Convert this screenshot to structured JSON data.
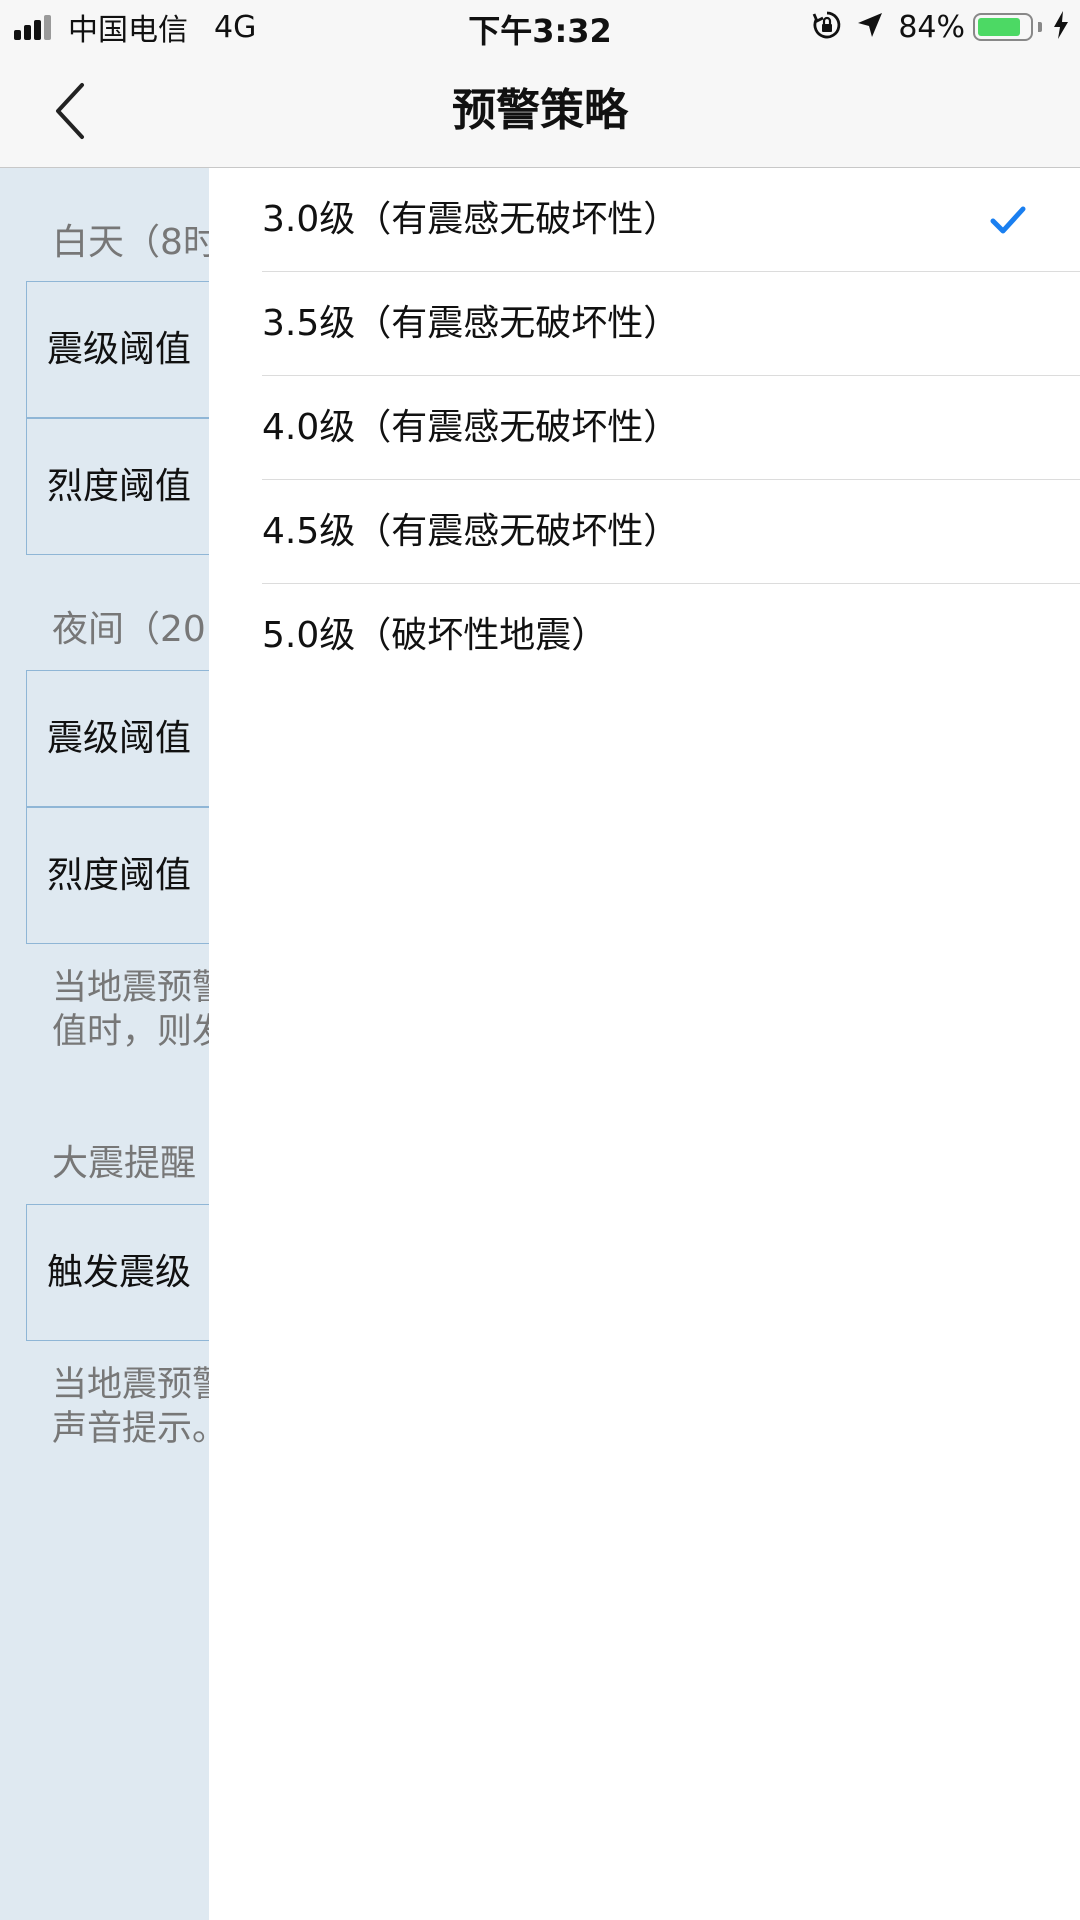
{
  "status_bar": {
    "carrier": "中国电信",
    "network": "4G",
    "time": "下午3:32",
    "battery_percent": "84%",
    "battery_level": 0.84,
    "icons": [
      "signal-icon",
      "rotation-lock-icon",
      "location-arrow-icon",
      "battery-icon",
      "charging-bolt-icon"
    ]
  },
  "nav": {
    "title": "预警策略",
    "back_icon": "chevron-left-icon"
  },
  "background_page": {
    "day_section_title": "白天（8时",
    "day_cells": [
      "震级阈值",
      "烈度阈值"
    ],
    "night_section_title": "夜间（20",
    "night_cells": [
      "震级阈值",
      "烈度阈值"
    ],
    "threshold_note": [
      "当地震预警",
      "值时，则发"
    ],
    "big_quake_section_title": "大震提醒",
    "big_quake_cells": [
      "触发震级"
    ],
    "big_quake_note": [
      "当地震预警",
      "声音提示。"
    ]
  },
  "options": [
    {
      "label": "3.0级（有震感无破坏性）",
      "selected": true
    },
    {
      "label": "3.5级（有震感无破坏性）",
      "selected": false
    },
    {
      "label": "4.0级（有震感无破坏性）",
      "selected": false
    },
    {
      "label": "4.5级（有震感无破坏性）",
      "selected": false
    },
    {
      "label": "5.0级（破坏性地震）",
      "selected": false
    }
  ],
  "colors": {
    "accent": "#1a7ff0",
    "dim_background": "#dfe9f1",
    "battery": "#4cd964"
  }
}
